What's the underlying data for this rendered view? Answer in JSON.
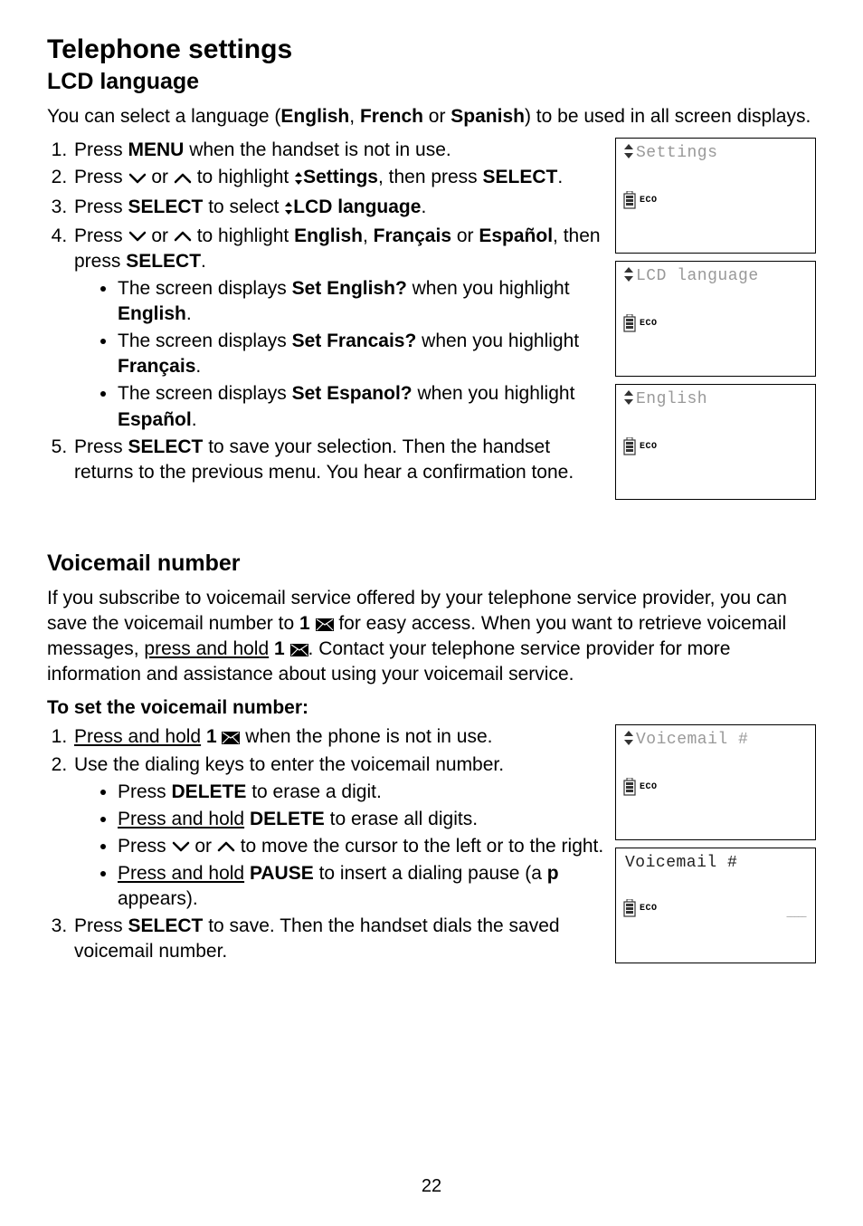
{
  "page_number": "22",
  "h1": "Telephone settings",
  "sec1": {
    "title": "LCD language",
    "intro_parts": [
      "You can select a language (",
      "English",
      ", ",
      "French",
      " or ",
      "Spanish",
      ") to be used in all screen displays."
    ],
    "steps": {
      "s1": [
        "Press ",
        "MENU",
        " when the handset is not in use."
      ],
      "s2a": "Press ",
      "s2b": " or ",
      "s2c": " to highlight ",
      "s2d": "Settings",
      "s2e": ", then press ",
      "s2f": "SELECT",
      "s2g": ".",
      "s3": [
        "Press ",
        "SELECT",
        " to select ",
        "LCD language",
        "."
      ],
      "s4a": "Press ",
      "s4b": " or ",
      "s4c": " to highlight ",
      "s4d": "English",
      "s4e": ", ",
      "s4f": "Français",
      "s4g": " or ",
      "s4h": "Español",
      "s4i": ", then press ",
      "s4j": "SELECT",
      "s4k": ".",
      "b1": [
        "The screen displays ",
        "Set English?",
        " when you highlight ",
        "English",
        "."
      ],
      "b2": [
        "The screen displays ",
        "Set Francais?",
        " when you highlight ",
        "Français",
        "."
      ],
      "b3": [
        "The screen displays ",
        "Set Espanol?",
        " when you highlight ",
        "Español",
        "."
      ],
      "s5": [
        "Press ",
        "SELECT",
        " to save your selection. Then the handset returns to the previous menu. You hear a confirmation tone."
      ]
    },
    "lcd1": "Settings",
    "lcd2": "LCD language",
    "lcd3": "English"
  },
  "sec2": {
    "title": "Voicemail number",
    "intro_a": "If you subscribe to voicemail service offered by your telephone service provider, you can save the voicemail number to ",
    "intro_b": "1",
    "intro_c": " for easy access. When you want to retrieve voicemail messages, ",
    "intro_d": "press and hold",
    "intro_e": " ",
    "intro_f": "1",
    "intro_g": ". Contact your telephone service provider for more information and assistance about using your voicemail service.",
    "subheading": "To set the voicemail number:",
    "s1a": "Press and hold",
    "s1b": " ",
    "s1c": "1",
    "s1d": " when the phone is not in use.",
    "s2": "Use the dialing keys to enter the voicemail number.",
    "b1": [
      "Press ",
      "DELETE",
      " to erase a digit."
    ],
    "b2a": "Press and hold",
    "b2b": " ",
    "b2c": "DELETE",
    "b2d": " to erase all digits.",
    "b3a": "Press ",
    "b3b": " or ",
    "b3c": " to move the cursor to the left or to the right.",
    "b4a": "Press and hold",
    "b4b": " ",
    "b4c": "PAUSE",
    "b4d": " to insert a dialing pause (a ",
    "b4e": "p",
    "b4f": " appears).",
    "s3": [
      "Press ",
      "SELECT",
      " to save. Then the handset dials the saved voicemail number."
    ],
    "lcd1": "Voicemail #",
    "lcd2": "Voicemail #"
  },
  "eco_label": "ECO"
}
